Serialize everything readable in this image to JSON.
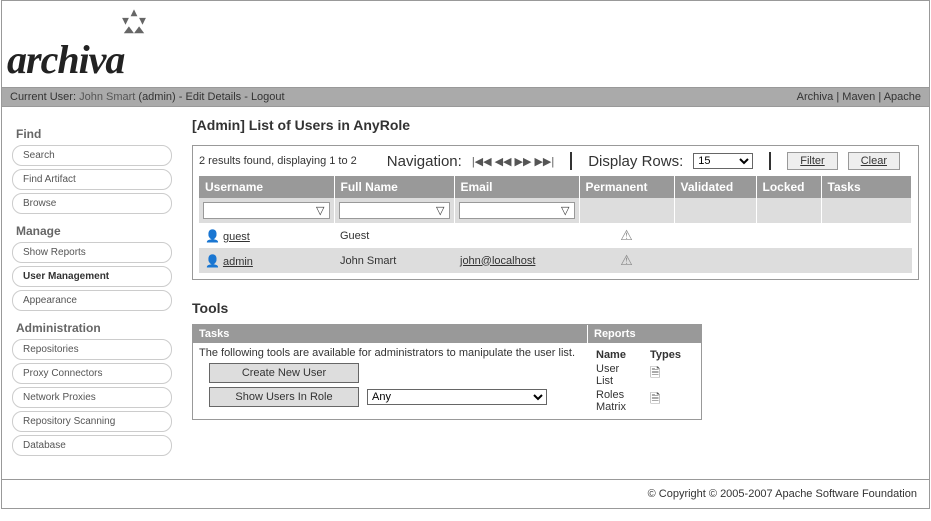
{
  "logo": {
    "text": "archiva"
  },
  "userbar": {
    "label": "Current User:",
    "username": "John Smart",
    "role": "(admin)",
    "sep": " - ",
    "edit": "Edit Details",
    "logout": "Logout",
    "links": {
      "archiva": "Archiva",
      "maven": "Maven",
      "apache": "Apache",
      "sep": " | "
    }
  },
  "sidebar": {
    "find": {
      "title": "Find",
      "items": [
        "Search",
        "Find Artifact",
        "Browse"
      ]
    },
    "manage": {
      "title": "Manage",
      "items": [
        "Show Reports",
        "User Management",
        "Appearance"
      ],
      "activeIndex": 1
    },
    "admin": {
      "title": "Administration",
      "items": [
        "Repositories",
        "Proxy Connectors",
        "Network Proxies",
        "Repository Scanning",
        "Database"
      ]
    }
  },
  "page_title": "[Admin] List of Users in AnyRole",
  "list": {
    "results_text": "2 results found, displaying 1 to 2",
    "nav_label": "Navigation:",
    "display_label": "Display Rows:",
    "rows_value": "15",
    "filter_btn": "Filter",
    "clear_btn": "Clear",
    "headers": {
      "username": "Username",
      "fullname": "Full Name",
      "email": "Email",
      "permanent": "Permanent",
      "validated": "Validated",
      "locked": "Locked",
      "tasks": "Tasks"
    },
    "rows": [
      {
        "username": "guest",
        "fullname": "Guest",
        "email": "",
        "permanent": true
      },
      {
        "username": "admin",
        "fullname": "John Smart",
        "email": "john@localhost",
        "permanent": true
      }
    ]
  },
  "tools": {
    "title": "Tools",
    "tasks_header": "Tasks",
    "reports_header": "Reports",
    "intro": "The following tools are available for administrators to manipulate the user list.",
    "create_btn": "Create New User",
    "show_btn": "Show Users In Role",
    "role_value": "Any",
    "reports": {
      "name_h": "Name",
      "types_h": "Types",
      "items": [
        "User List",
        "Roles Matrix"
      ]
    }
  },
  "footer": "© Copyright © 2005-2007 Apache Software Foundation"
}
